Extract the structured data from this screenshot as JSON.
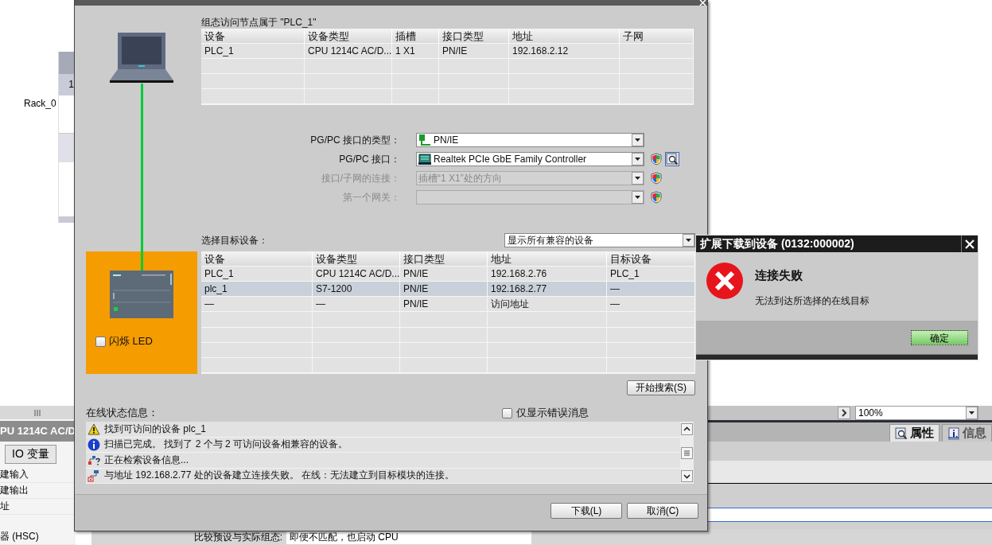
{
  "background": {
    "rack_label": "Rack_0",
    "rack_slot": "1",
    "device_header": "PU 1214C AC/D",
    "io_tab": "IO 变量",
    "property_items": [
      "建输入",
      "建输出",
      "址",
      "器 (HSC)"
    ],
    "startup_label": "比较预设与实际组态:",
    "startup_value": "即便不匹配，也启动 CPU",
    "zoom": "100%",
    "inspector_tabs": [
      {
        "label": "属性",
        "selected": true,
        "kind": "properties"
      },
      {
        "label": "信息",
        "selected": false,
        "kind": "info"
      }
    ]
  },
  "download_dialog": {
    "node_heading": "组态访问节点属于 \"PLC_1\"",
    "node_table": {
      "columns": [
        "设备",
        "设备类型",
        "插槽",
        "接口类型",
        "地址",
        "子网"
      ],
      "rows": [
        [
          "PLC_1",
          "CPU 1214C AC/D...",
          "1 X1",
          "PN/IE",
          "192.168.2.12"
        ]
      ]
    },
    "interface": [
      {
        "label": "PG/PC 接口的类型：",
        "value": "PN/IE",
        "kind": "network",
        "disabled": false,
        "security": false,
        "diagnostics": false
      },
      {
        "label": "PG/PC 接口：",
        "value": "Realtek PCIe GbE Family Controller",
        "kind": "adapter",
        "disabled": false,
        "security": true,
        "diagnostics": true
      },
      {
        "label": "接口/子网的连接：",
        "value": "插槽“1 X1”处的方向",
        "disabled": true,
        "security": true,
        "diagnostics": false
      },
      {
        "label": "第一个网关：",
        "disabled": true,
        "security": true,
        "diagnostics": false
      }
    ],
    "target_heading": "选择目标设备：",
    "target_filter": "显示所有兼容的设备",
    "target_table": {
      "columns": [
        "设备",
        "设备类型",
        "接口类型",
        "地址",
        "目标设备"
      ],
      "rows": [
        {
          "cells": [
            "PLC_1",
            "CPU 1214C AC/D...",
            "PN/IE",
            "192.168.2.76",
            "PLC_1"
          ],
          "selected": false
        },
        {
          "cells": [
            "plc_1",
            "S7-1200",
            "PN/IE",
            "192.168.2.77",
            "—"
          ],
          "selected": true
        },
        {
          "cells": [
            "—",
            "—",
            "PN/IE",
            "访问地址",
            "—"
          ],
          "selected": false
        }
      ]
    },
    "flash_led": {
      "label": "闪烁 LED",
      "checked": false
    },
    "search_button": "开始搜索(S)",
    "status_heading": "在线状态信息：",
    "errors_only": {
      "label": "仅显示错误消息",
      "checked": false
    },
    "messages": [
      {
        "kind": "warning",
        "text": "找到可访问的设备 plc_1"
      },
      {
        "kind": "info",
        "text": "扫描已完成。 找到了 2 个与 2 可访问设备相兼容的设备。"
      },
      {
        "kind": "searching",
        "text": "正在检索设备信息..."
      },
      {
        "kind": "error",
        "text": "与地址 192.168.2.77 处的设备建立连接失败。 在线：无法建立到目标模块的连接。"
      }
    ],
    "buttons": [
      "下载(L)",
      "取消(C)"
    ]
  },
  "error_dialog": {
    "title": "扩展下载到设备 (0132:000002)",
    "heading": "连接失败",
    "message": "无法到达所选择的在线目标",
    "button": "确定"
  }
}
